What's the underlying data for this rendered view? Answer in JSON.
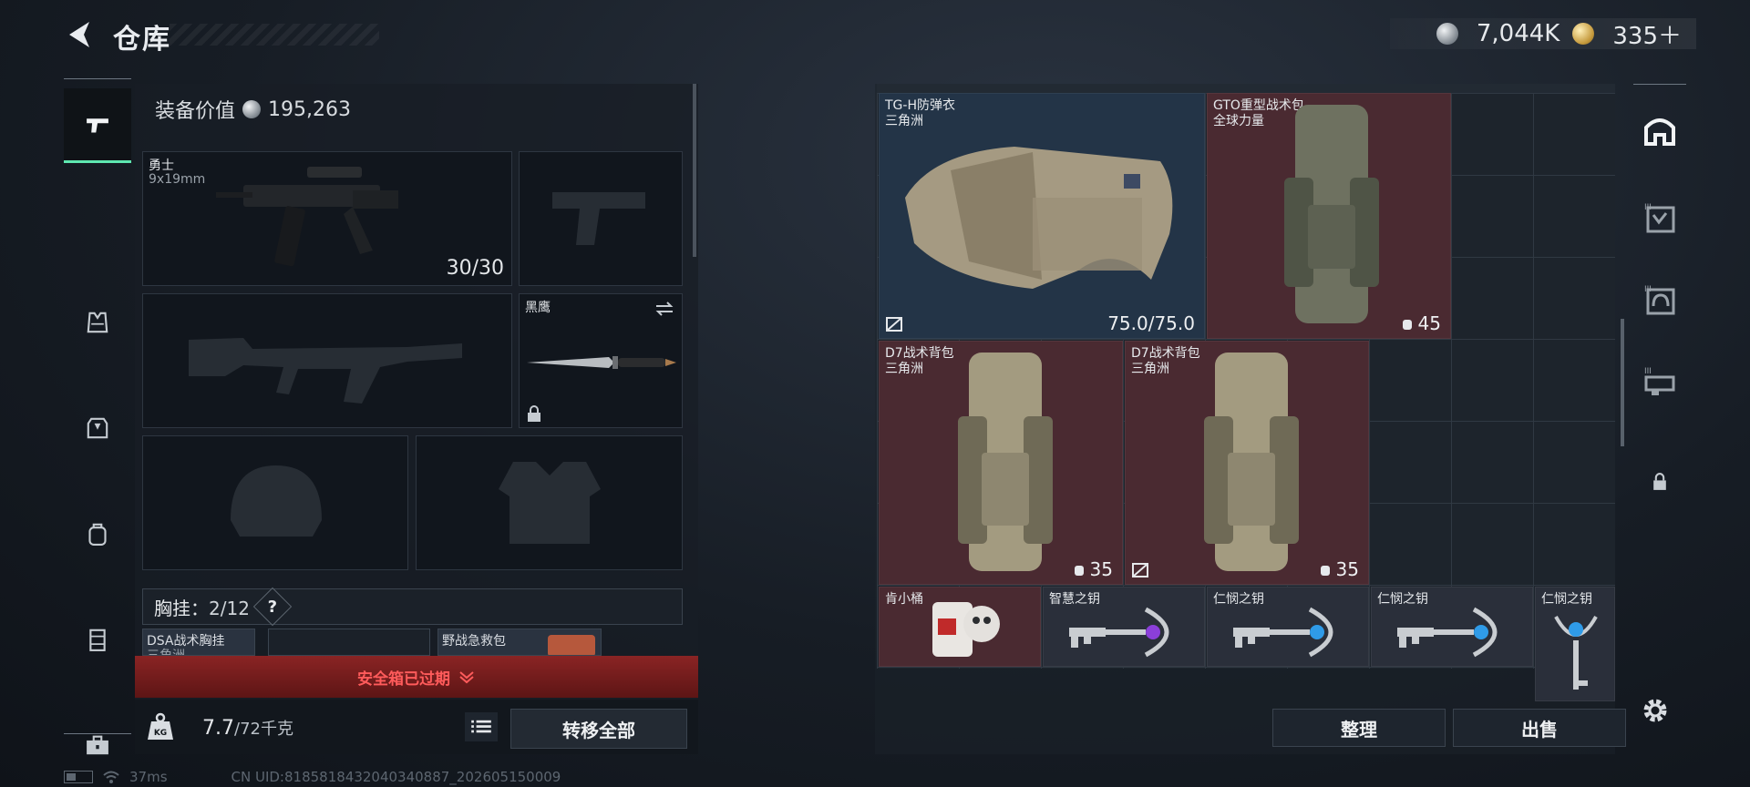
{
  "header": {
    "title": "仓库"
  },
  "currency": {
    "silver": "7,044K",
    "gold": "335＋"
  },
  "left_nav": {
    "items": [
      {
        "icon": "pistol-icon",
        "active": true
      },
      {
        "icon": "vest-icon"
      },
      {
        "icon": "armor-icon"
      },
      {
        "icon": "backpack-icon"
      },
      {
        "icon": "container-icon"
      },
      {
        "icon": "toolbox-icon"
      }
    ]
  },
  "loadout": {
    "value_label": "装备价值",
    "value": "195,263",
    "primary": {
      "name": "勇士",
      "caliber": "9x19mm",
      "ammo": "30/30"
    },
    "melee": {
      "name": "黑鹰"
    },
    "chest_rig_label": "胸挂：",
    "chest_rig_count": "2/12",
    "help": "?",
    "mini_items": [
      "DSA战术胸挂",
      "三角洲",
      "野战急救包"
    ],
    "warning": "安全箱已过期",
    "weight": "7.7",
    "weight_max": "/72千克",
    "weight_icon_text": "KG",
    "transfer_all": "转移全部"
  },
  "status": {
    "ping": "37ms",
    "uid": "CN UID:8185818432040340887_202605150009"
  },
  "storage": {
    "items": [
      {
        "name": "TG-H防弹衣",
        "sub": "三角洲",
        "durability": "75.0/75.0",
        "color": "blue"
      },
      {
        "name": "GTO重型战术包",
        "sub": "全球力量",
        "capacity": "45",
        "color": "red"
      },
      {
        "name": "D7战术背包",
        "sub": "三角洲",
        "capacity": "35",
        "color": "red"
      },
      {
        "name": "D7战术背包",
        "sub": "三角洲",
        "capacity": "35",
        "color": "red"
      },
      {
        "name": "肯小桶",
        "color": "red"
      },
      {
        "name": "智慧之钥",
        "color": "gray"
      },
      {
        "name": "仁悯之钥",
        "color": "gray"
      },
      {
        "name": "仁悯之钥",
        "color": "gray"
      },
      {
        "name": "仁悯之钥",
        "color": "gray"
      }
    ],
    "tidy": "整理",
    "sell": "出售"
  },
  "right_nav": {
    "items": [
      "safehouse-icon",
      "tier3-armor-icon",
      "tier3-helmet-icon",
      "tier3-rig-icon",
      "lock-icon"
    ]
  },
  "colors": {
    "accent": "#5ee7b0",
    "warning": "#ff5b5b",
    "slot_red": "#4a2a31",
    "slot_blue": "#233447"
  }
}
